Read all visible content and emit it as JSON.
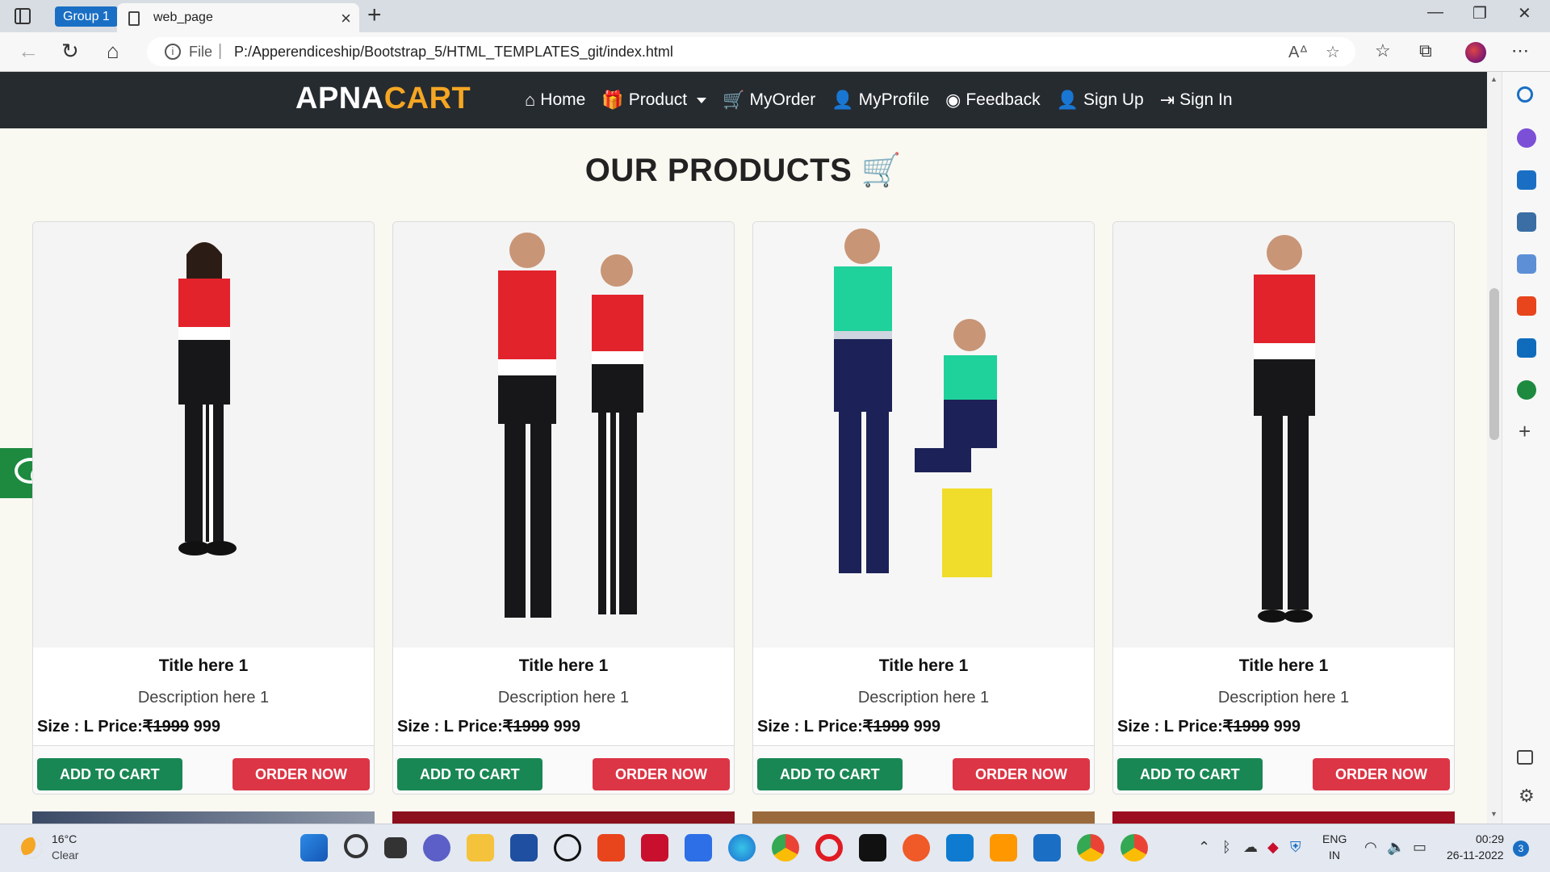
{
  "browser": {
    "tab_group": "Group 1",
    "tab_title": "web_page",
    "file_label": "File",
    "url": "P:/Apperendiceship/Bootstrap_5/HTML_TEMPLATES_git/index.html"
  },
  "navbar": {
    "brand_main": "APNA",
    "brand_accent": "CART",
    "links": [
      {
        "label": "Home",
        "icon": "home-icon"
      },
      {
        "label": "Product",
        "icon": "gift-icon"
      },
      {
        "label": "MyOrder",
        "icon": "cart-icon"
      },
      {
        "label": "MyProfile",
        "icon": "user-icon"
      },
      {
        "label": "Feedback",
        "icon": "rss-icon"
      },
      {
        "label": "Sign Up",
        "icon": "user-plus-icon"
      },
      {
        "label": "Sign In",
        "icon": "sign-in-icon"
      }
    ]
  },
  "section": {
    "title_light": "OUR",
    "title_bold": "PRODUCTS"
  },
  "products": [
    {
      "title": "Title here 1",
      "description": "Description here 1",
      "size_price_label": "Size : L Price:",
      "old_price": "₹1999",
      "new_price": "999",
      "cart_label": "ADD TO CART",
      "order_label": "ORDER NOW"
    },
    {
      "title": "Title here 1",
      "description": "Description here 1",
      "size_price_label": "Size : L Price:",
      "old_price": "₹1999",
      "new_price": "999",
      "cart_label": "ADD TO CART",
      "order_label": "ORDER NOW"
    },
    {
      "title": "Title here 1",
      "description": "Description here 1",
      "size_price_label": "Size : L Price:",
      "old_price": "₹1999",
      "new_price": "999",
      "cart_label": "ADD TO CART",
      "order_label": "ORDER NOW"
    },
    {
      "title": "Title here 1",
      "description": "Description here 1",
      "size_price_label": "Size : L Price:",
      "old_price": "₹1999",
      "new_price": "999",
      "cart_label": "ADD TO CART",
      "order_label": "ORDER NOW"
    }
  ],
  "taskbar": {
    "temperature": "16°C",
    "condition": "Clear",
    "lang_top": "ENG",
    "lang_bottom": "IN",
    "time": "00:29",
    "date": "26-11-2022",
    "notification_count": "3"
  },
  "colors": {
    "navbar_bg": "#262b30",
    "brand_accent": "#f5a623",
    "cart_button": "#198754",
    "order_button": "#dc3545"
  }
}
